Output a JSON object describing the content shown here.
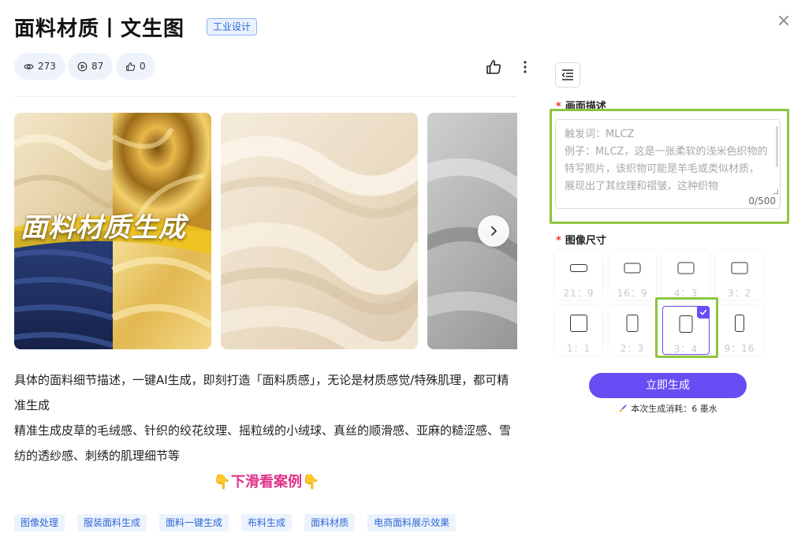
{
  "header": {
    "title": "面料材质丨文生图",
    "badge": "工业设计",
    "close_label": "×"
  },
  "stats": {
    "views": "273",
    "plays": "87",
    "likes": "0"
  },
  "gallery": {
    "overlay_title": "面料材质生成"
  },
  "description": {
    "line1": "具体的面料细节描述，一键AI生成，即刻打造「面料质感」，无论是材质感觉/特殊肌理，都可精准生成",
    "line2": "精准生成皮草的毛绒感、针织的绞花纹理、摇粒绒的小绒球、真丝的顺滑感、亚麻的糙涩感、雪纺的透纱感、刺绣的肌理细节等",
    "scroll_hint": "👇下滑看案例👇"
  },
  "tags": [
    "图像处理",
    "服装面料生成",
    "面料一键生成",
    "布料生成",
    "面料材质",
    "电商面料展示效果"
  ],
  "form": {
    "prompt_label": "画面描述",
    "prompt_value": "",
    "prompt_placeholder": "触发词：MLCZ\n例子：MLCZ，这是一张柔软的浅米色织物的特写照片，该织物可能是羊毛或类似材质，展现出了其纹理和褶皱，这种织物",
    "char_count": "0/500",
    "size_label": "图像尺寸",
    "ratios": [
      {
        "label": "21：9",
        "w": 21,
        "h": 9
      },
      {
        "label": "16：9",
        "w": 16,
        "h": 9
      },
      {
        "label": "4：3",
        "w": 4,
        "h": 3
      },
      {
        "label": "3：2",
        "w": 3,
        "h": 2
      },
      {
        "label": "1：1",
        "w": 1,
        "h": 1
      },
      {
        "label": "2：3",
        "w": 2,
        "h": 3
      },
      {
        "label": "3：4",
        "w": 3,
        "h": 4
      },
      {
        "label": "9：16",
        "w": 9,
        "h": 16
      }
    ],
    "selected_ratio": "3：4",
    "generate_label": "立即生成",
    "cost_text": "本次生成消耗：6 墨水"
  },
  "colors": {
    "accent": "#6a4cf5",
    "highlight": "#8cc63f",
    "tag_text": "#2b67d8",
    "hint": "#e0318a"
  }
}
